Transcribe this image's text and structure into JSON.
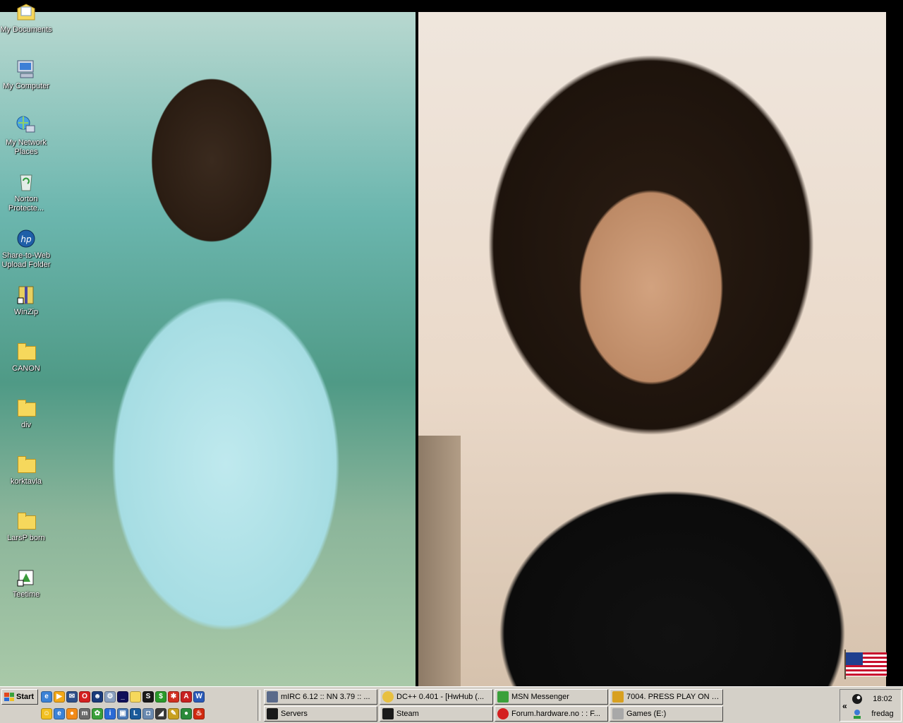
{
  "desktop": {
    "icons": [
      {
        "label": "My Documents",
        "icon": "my-documents-icon"
      },
      {
        "label": "My Computer",
        "icon": "my-computer-icon"
      },
      {
        "label": "My Network\nPlaces",
        "icon": "network-places-icon"
      },
      {
        "label": "Norton\nProtecte...",
        "icon": "recycle-bin-icon"
      },
      {
        "label": "Share-to-Web\nUpload Folder",
        "icon": "hp-share-icon"
      },
      {
        "label": "WinZip",
        "icon": "winzip-icon"
      },
      {
        "label": "CANON",
        "icon": "folder-icon"
      },
      {
        "label": "div",
        "icon": "folder-icon"
      },
      {
        "label": "korktavla",
        "icon": "folder-icon"
      },
      {
        "label": "LarsP born",
        "icon": "folder-icon"
      },
      {
        "label": "Teetime",
        "icon": "teetime-icon"
      }
    ]
  },
  "taskbar": {
    "start_label": "Start",
    "quicklaunch_row1": [
      "ie-icon",
      "media-player-icon",
      "mail-icon",
      "opera-icon",
      "person-icon",
      "network-icon",
      "cmd-icon",
      "folder-icon",
      "steam-icon",
      "green-app-icon",
      "red-app-icon",
      "ati-icon",
      "word-icon"
    ],
    "quicklaunch_row2": [
      "smiley-icon",
      "ie2-icon",
      "media-icon",
      "mirc-icon",
      "msn-icon",
      "info-icon",
      "app-icon",
      "app2-icon",
      "photo-icon",
      "winamp-icon",
      "edit-icon",
      "chrome-ball-icon",
      "flame-icon"
    ],
    "buttons_row1": [
      {
        "label": "mIRC 6.12 :: NN 3.79 :: ...",
        "icon": "mirc-icon"
      },
      {
        "label": "DC++ 0.401 - [HwHub (...",
        "icon": "dcpp-icon"
      },
      {
        "label": "MSN Messenger",
        "icon": "msn-icon"
      },
      {
        "label": "7004. PRESS PLAY ON T...",
        "icon": "winamp-icon"
      }
    ],
    "buttons_row2": [
      {
        "label": "Servers",
        "icon": "steam-icon"
      },
      {
        "label": "Steam",
        "icon": "steam-icon"
      },
      {
        "label": "Forum.hardware.no : : F...",
        "icon": "opera-icon"
      },
      {
        "label": "Games (E:)",
        "icon": "drive-icon"
      }
    ],
    "tray": {
      "chevron": "«",
      "clock": "18:02",
      "day": "fredag"
    }
  }
}
